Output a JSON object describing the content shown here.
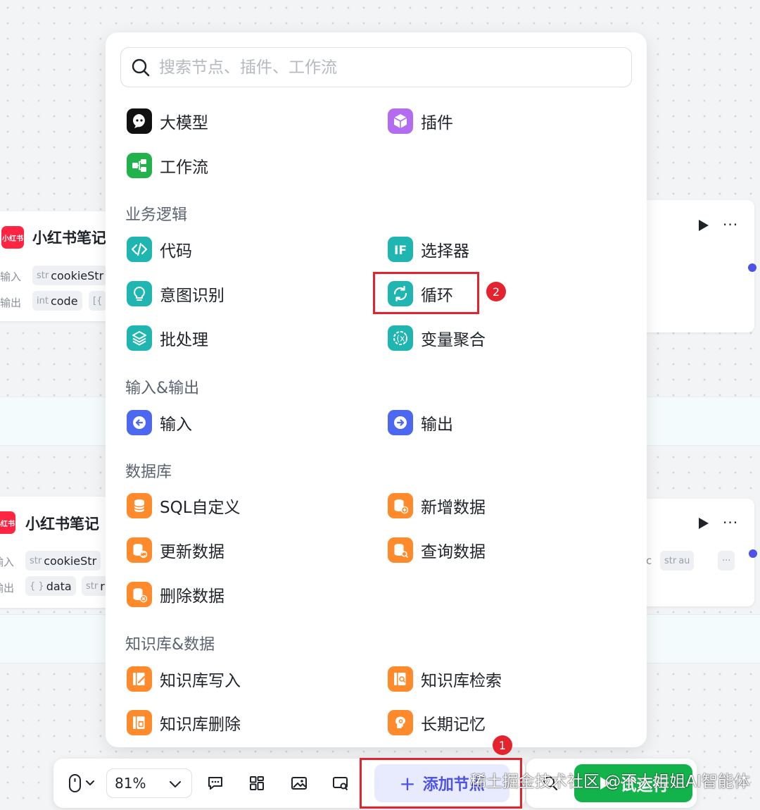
{
  "canvas": {
    "node_top": {
      "title": "小红书笔记",
      "logo_text": "小红书",
      "input_label": "输入",
      "output_label": "输出",
      "input_param": {
        "type": "str",
        "name": "cookieStr"
      },
      "output_param": {
        "type": "int",
        "name": "code"
      },
      "output_extra_type": "[{"
    },
    "node_bottom": {
      "title": "小红书笔记",
      "logo_text": "小红书",
      "input_label": "输入",
      "output_label": "输出",
      "input_param": {
        "type": "str",
        "name": "cookieStr"
      },
      "output_param": {
        "type": "{ }",
        "name": "data"
      },
      "output_extra_type": "str",
      "output_extra_name": "r"
    },
    "node_right_bottom": {
      "chip_c": "c",
      "chip_type": "str",
      "chip_name": "au"
    }
  },
  "panel": {
    "search_placeholder": "搜索节点、插件、工作流",
    "top_items": [
      {
        "label": "大模型",
        "icon": "llm-icon"
      },
      {
        "label": "插件",
        "icon": "plugin-cube-icon"
      },
      {
        "label": "工作流",
        "icon": "workflow-icon"
      }
    ],
    "sections": [
      {
        "title": "业务逻辑",
        "items": [
          {
            "label": "代码",
            "icon": "code-icon"
          },
          {
            "label": "选择器",
            "icon": "if-selector-icon"
          },
          {
            "label": "意图识别",
            "icon": "intent-bulb-icon"
          },
          {
            "label": "循环",
            "icon": "loop-icon"
          },
          {
            "label": "批处理",
            "icon": "batch-layers-icon"
          },
          {
            "label": "变量聚合",
            "icon": "variable-merge-icon"
          }
        ]
      },
      {
        "title": "输入&输出",
        "items": [
          {
            "label": "输入",
            "icon": "input-arrow-icon"
          },
          {
            "label": "输出",
            "icon": "output-arrow-icon"
          }
        ]
      },
      {
        "title": "数据库",
        "items": [
          {
            "label": "SQL自定义",
            "icon": "database-icon"
          },
          {
            "label": "新增数据",
            "icon": "database-add-icon"
          },
          {
            "label": "更新数据",
            "icon": "database-update-icon"
          },
          {
            "label": "查询数据",
            "icon": "database-search-icon"
          },
          {
            "label": "删除数据",
            "icon": "database-delete-icon"
          }
        ]
      },
      {
        "title": "知识库&数据",
        "items": [
          {
            "label": "知识库写入",
            "icon": "knowledge-write-icon"
          },
          {
            "label": "知识库检索",
            "icon": "knowledge-search-icon"
          },
          {
            "label": "知识库删除",
            "icon": "knowledge-delete-icon"
          },
          {
            "label": "长期记忆",
            "icon": "long-memory-icon"
          }
        ]
      }
    ]
  },
  "annotations": {
    "badge_1": "1",
    "badge_2": "2"
  },
  "toolbar": {
    "zoom_value": "81%",
    "add_node_label": "添加节点",
    "try_run_label": "试运行"
  },
  "watermark": "稀土掘金技术社区 @不大姐姐AI智能体",
  "colors": {
    "accent": "#4d53e8",
    "run_green": "#13b34b",
    "annotation_red": "#e5232f",
    "teal_icon": "#1fb5b0",
    "orange_icon": "#ff8a2b",
    "brand_red": "#ff2442"
  }
}
